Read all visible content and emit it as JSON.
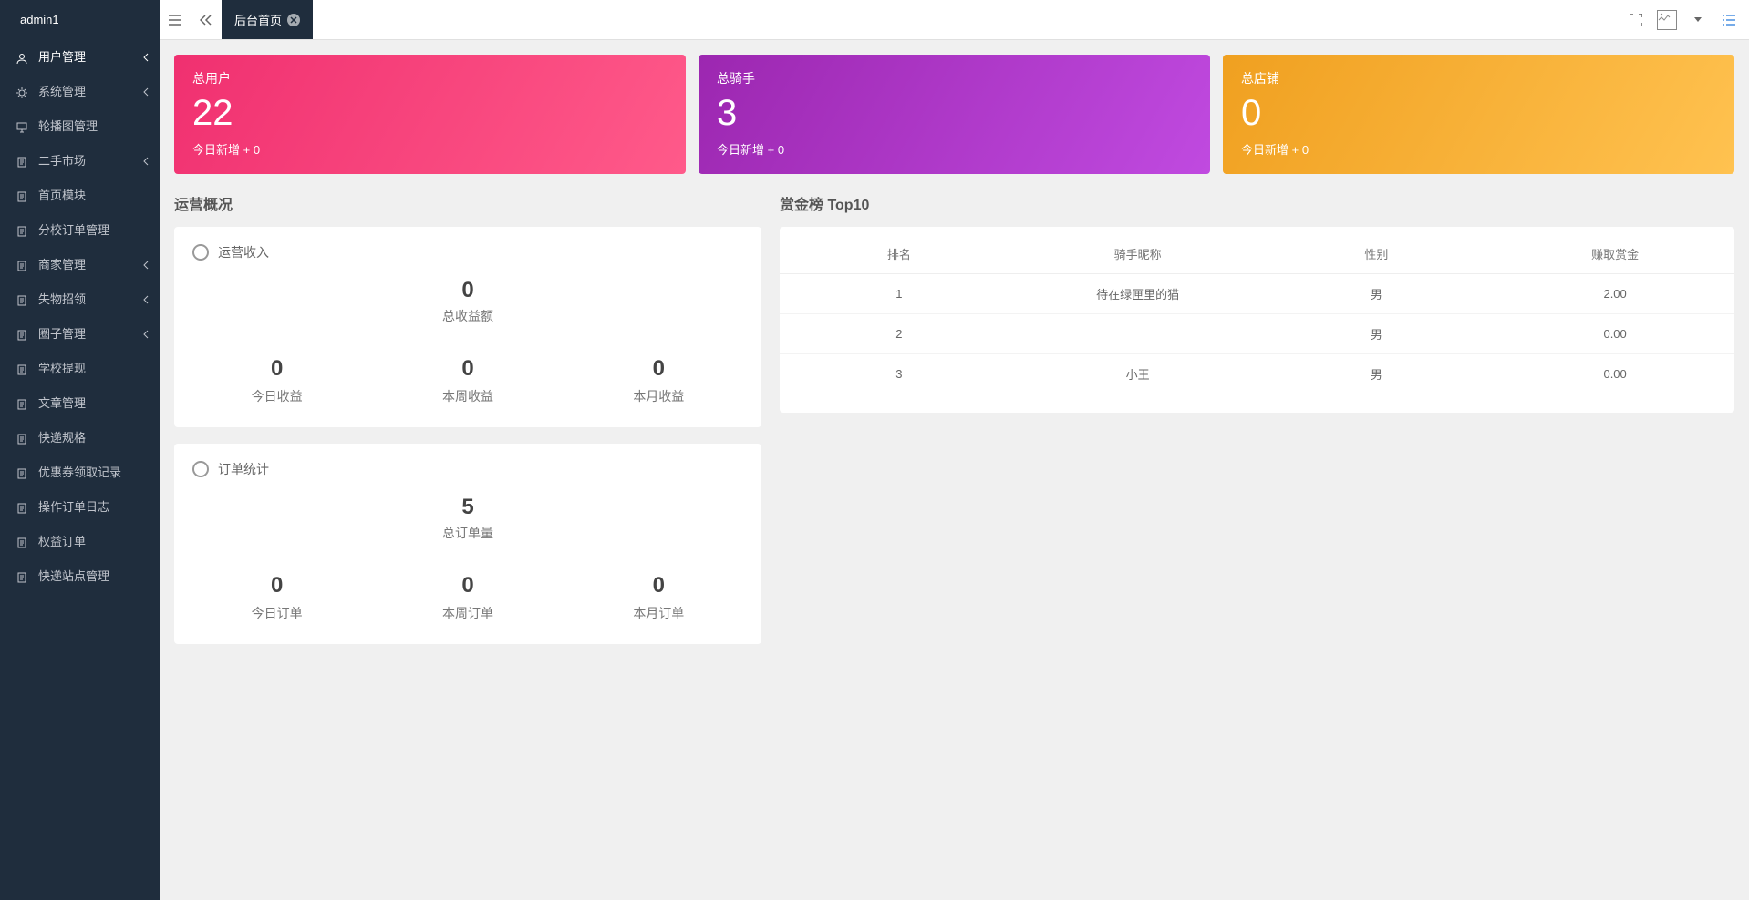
{
  "sidebar": {
    "header": "admin1",
    "items": [
      {
        "label": "用户管理",
        "icon": "user",
        "expandable": true,
        "active": true
      },
      {
        "label": "系统管理",
        "icon": "gears",
        "expandable": true
      },
      {
        "label": "轮播图管理",
        "icon": "monitor",
        "expandable": false
      },
      {
        "label": "二手市场",
        "icon": "doc",
        "expandable": true
      },
      {
        "label": "首页模块",
        "icon": "doc",
        "expandable": false
      },
      {
        "label": "分校订单管理",
        "icon": "doc",
        "expandable": false
      },
      {
        "label": "商家管理",
        "icon": "doc",
        "expandable": true
      },
      {
        "label": "失物招领",
        "icon": "doc",
        "expandable": true
      },
      {
        "label": "圈子管理",
        "icon": "doc",
        "expandable": true
      },
      {
        "label": "学校提现",
        "icon": "doc",
        "expandable": false
      },
      {
        "label": "文章管理",
        "icon": "doc",
        "expandable": false
      },
      {
        "label": "快递规格",
        "icon": "doc",
        "expandable": false
      },
      {
        "label": "优惠券领取记录",
        "icon": "doc",
        "expandable": false
      },
      {
        "label": "操作订单日志",
        "icon": "doc",
        "expandable": false
      },
      {
        "label": "权益订单",
        "icon": "doc",
        "expandable": false
      },
      {
        "label": "快递站点管理",
        "icon": "doc",
        "expandable": false
      }
    ]
  },
  "topbar": {
    "tab_label": "后台首页"
  },
  "stats": {
    "users": {
      "title": "总用户",
      "value": "22",
      "sub": "今日新增 + 0"
    },
    "riders": {
      "title": "总骑手",
      "value": "3",
      "sub": "今日新增 + 0"
    },
    "shops": {
      "title": "总店铺",
      "value": "0",
      "sub": "今日新增 + 0"
    }
  },
  "overview": {
    "title": "运营概况",
    "income": {
      "head": "运营收入",
      "total": {
        "value": "0",
        "label": "总收益额"
      },
      "items": [
        {
          "value": "0",
          "label": "今日收益"
        },
        {
          "value": "0",
          "label": "本周收益"
        },
        {
          "value": "0",
          "label": "本月收益"
        }
      ]
    },
    "orders": {
      "head": "订单统计",
      "total": {
        "value": "5",
        "label": "总订单量"
      },
      "items": [
        {
          "value": "0",
          "label": "今日订单"
        },
        {
          "value": "0",
          "label": "本周订单"
        },
        {
          "value": "0",
          "label": "本月订单"
        }
      ]
    }
  },
  "ranking": {
    "title": "赏金榜 Top10",
    "headers": {
      "rank": "排名",
      "name": "骑手昵称",
      "gender": "性别",
      "amount": "赚取赏金"
    },
    "rows": [
      {
        "rank": "1",
        "name": "待在绿匣里的猫",
        "gender": "男",
        "amount": "2.00"
      },
      {
        "rank": "2",
        "name": "",
        "gender": "男",
        "amount": "0.00"
      },
      {
        "rank": "3",
        "name": "小王",
        "gender": "男",
        "amount": "0.00"
      }
    ]
  }
}
